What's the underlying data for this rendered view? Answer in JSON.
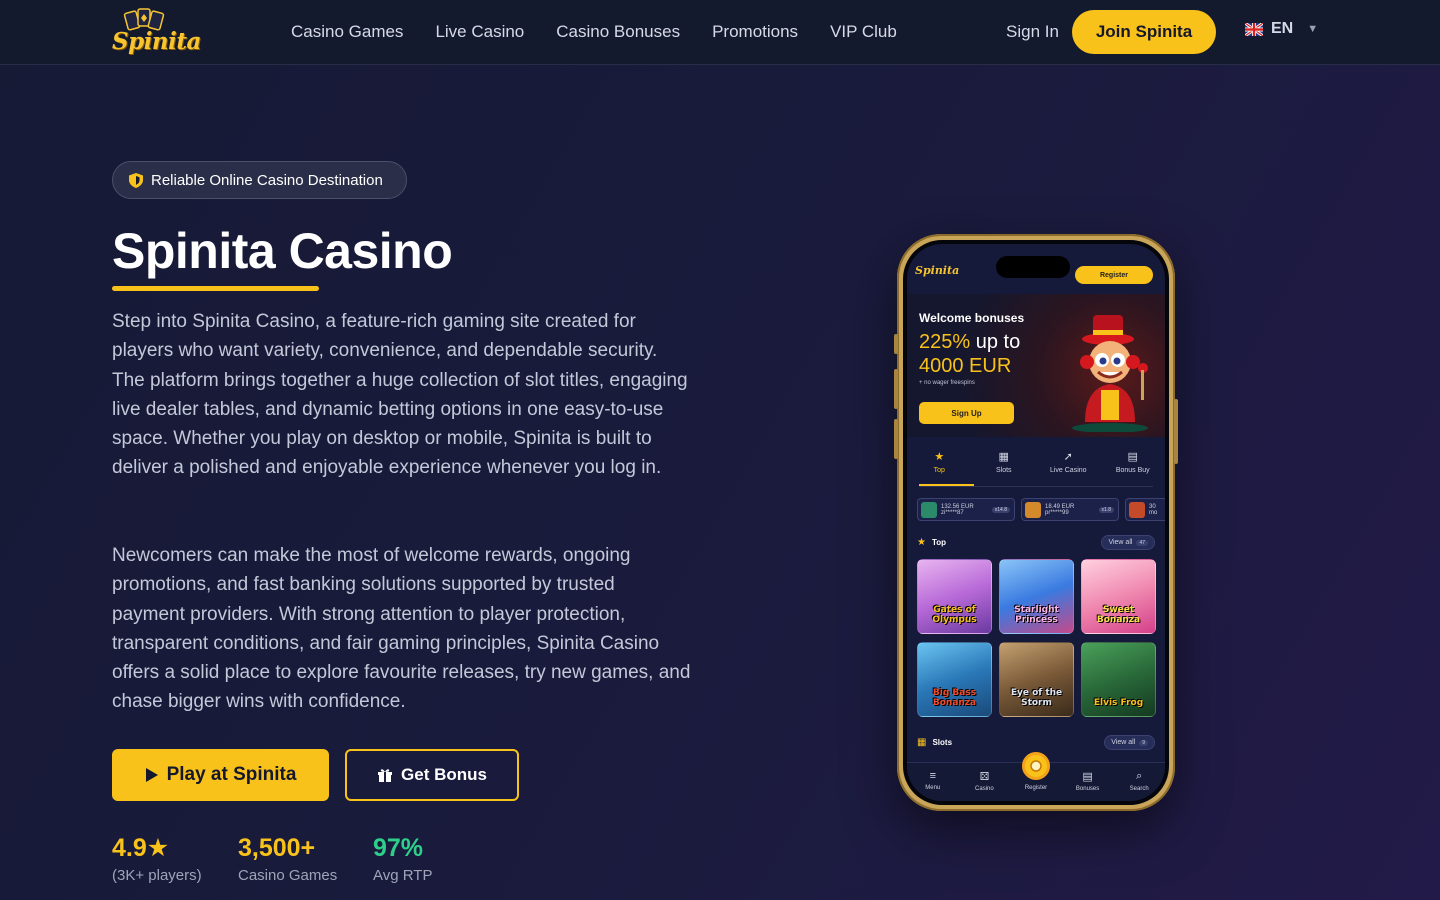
{
  "header": {
    "logo_text": "Spinita",
    "nav": [
      "Casino Games",
      "Live Casino",
      "Casino Bonuses",
      "Promotions",
      "VIP Club"
    ],
    "signin": "Sign In",
    "join": "Join Spinita",
    "lang_code": "EN",
    "lang_icon": "uk-flag-icon"
  },
  "hero": {
    "badge": "Reliable Online Casino Destination",
    "badge_icon": "shield-icon",
    "title": "Spinita Casino",
    "para1": "Step into Spinita Casino, a feature-rich gaming site created for players who want variety, convenience, and dependable security. The platform brings together a huge collection of slot titles, engaging live dealer tables, and dynamic betting options in one easy-to-use space. Whether you play on desktop or mobile, Spinita is built to deliver a polished and enjoyable experience whenever you log in.",
    "para2": "Newcomers can make the most of welcome rewards, ongoing promotions, and fast banking solutions supported by trusted payment providers. With strong attention to player protection, transparent conditions, and fair gaming principles, Spinita Casino offers a solid place to explore favourite releases, try new games, and chase bigger wins with confidence.",
    "btn_play": "Play at Spinita",
    "btn_bonus": "Get Bonus",
    "stats": [
      {
        "value": "4.9★",
        "label": "(3K+ players)",
        "color": "#f9c21b"
      },
      {
        "value": "3,500+",
        "label": "Casino Games",
        "color": "#f9c21b"
      },
      {
        "value": "97%",
        "label": "Avg RTP",
        "color": "#2ecf8a"
      }
    ]
  },
  "phone": {
    "logo": "Spinita",
    "register": "Register",
    "welcome": "Welcome bonuses",
    "offer_pct": "225%",
    "offer_upto": " up to",
    "offer_amount": "4000 EUR",
    "no_wager": "+ no wager freespins",
    "signup": "Sign Up",
    "tabs": [
      "Top",
      "Slots",
      "Live Casino",
      "Bonus Buy"
    ],
    "winners": [
      {
        "amount": "132.56 EUR",
        "user": "zi*****87",
        "mult": "x14.8"
      },
      {
        "amount": "18.49 EUR",
        "user": "pr*****99",
        "mult": "x1.8"
      },
      {
        "amount": "30",
        "user": "mo",
        "mult": ""
      }
    ],
    "section_top": "Top",
    "section_slots": "Slots",
    "view_all": "View all",
    "top_count": "47",
    "slots_count": "9",
    "games": [
      {
        "name": "Gates of Olympus",
        "bg": "#b86ad8",
        "fg": "#f9c21b"
      },
      {
        "name": "Starlight Princess",
        "bg": "#3a7ae0",
        "fg": "#ffb6e6"
      },
      {
        "name": "Sweet Bonanza",
        "bg": "#f08ab0",
        "fg": "#ffe14a"
      },
      {
        "name": "Big Bass Bonanza",
        "bg": "#2a78b8",
        "fg": "#f24a2a"
      },
      {
        "name": "Eye of the Storm",
        "bg": "#7a5a38",
        "fg": "#e0e6f0"
      },
      {
        "name": "Elvis Frog",
        "bg": "#2a6a3a",
        "fg": "#f9c21b"
      }
    ],
    "bottom_nav": [
      "Menu",
      "Casino",
      "Register",
      "Bonuses",
      "Search"
    ]
  }
}
